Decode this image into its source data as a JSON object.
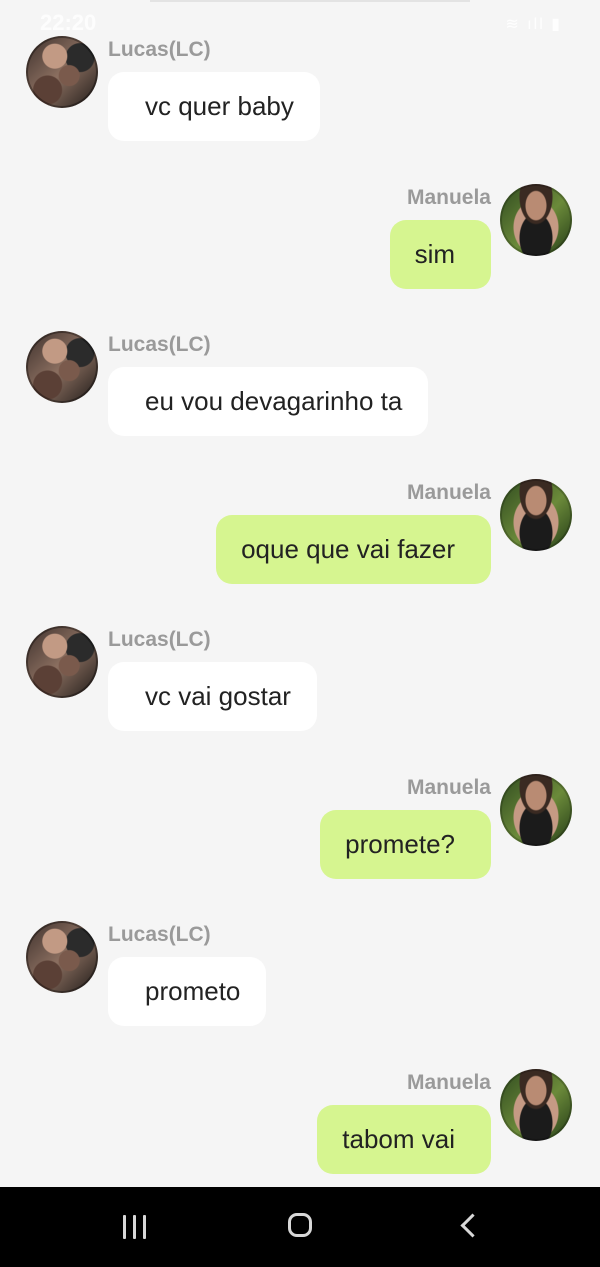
{
  "status_bar": {
    "time": "22:20",
    "icons": "≋ ıll ▮"
  },
  "messages": [
    {
      "side": "left",
      "sender": "Lucas(LC)",
      "text": "vc quer baby"
    },
    {
      "side": "right",
      "sender": "Manuela",
      "text": "sim"
    },
    {
      "side": "left",
      "sender": "Lucas(LC)",
      "text": "eu vou devagarinho ta"
    },
    {
      "side": "right",
      "sender": "Manuela",
      "text": "oque que vai fazer"
    },
    {
      "side": "left",
      "sender": "Lucas(LC)",
      "text": "vc vai gostar"
    },
    {
      "side": "right",
      "sender": "Manuela",
      "text": "promete?"
    },
    {
      "side": "left",
      "sender": "Lucas(LC)",
      "text": "prometo"
    },
    {
      "side": "right",
      "sender": "Manuela",
      "text": "tabom vai"
    }
  ],
  "nav_bar": {
    "recents_icon": "recents-icon",
    "home_icon": "home-icon",
    "back_icon": "back-icon"
  },
  "colors": {
    "background": "#f5f5f5",
    "incoming_bubble": "#ffffff",
    "outgoing_bubble": "#d6f590",
    "sender_name": "#9a9a9a",
    "nav_bar": "#000000"
  }
}
